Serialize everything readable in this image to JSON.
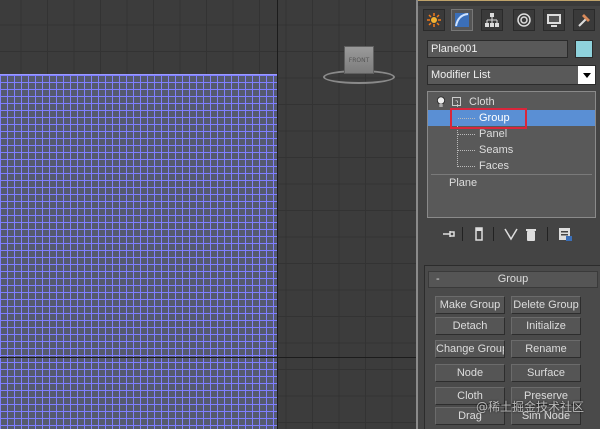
{
  "viewport": {
    "viewcube_label": "FRONT"
  },
  "panel": {
    "tabs": [
      {
        "name": "create",
        "icon": "sunburst-icon"
      },
      {
        "name": "modify",
        "icon": "modify-arc-icon"
      },
      {
        "name": "hierarchy",
        "icon": "hierarchy-icon"
      },
      {
        "name": "motion",
        "icon": "motion-icon"
      },
      {
        "name": "display",
        "icon": "display-monitor-icon"
      },
      {
        "name": "utilities",
        "icon": "hammer-icon"
      }
    ],
    "object_name": "Plane001",
    "object_color": "#8fd2dc",
    "modifier_list_label": "Modifier List",
    "stack": {
      "modifier": "Cloth",
      "subobjects": [
        "Group",
        "Panel",
        "Seams",
        "Faces"
      ],
      "selected": "Group",
      "base_object": "Plane"
    },
    "rollout": {
      "title": "Group",
      "collapse_symbol": "-",
      "buttons": [
        [
          "Make Group",
          "Delete Group"
        ],
        [
          "Detach",
          "Initialize"
        ],
        [
          "Change Group",
          "Rename"
        ],
        [
          "Node",
          "Surface"
        ],
        [
          "Cloth",
          "Preserve"
        ],
        [
          "Drag",
          "Sim Node"
        ]
      ]
    }
  },
  "colors": {
    "selection_highlight": "#5a8fd4",
    "annotation_box": "#d9263b",
    "mesh_wire": "#7f7fff"
  },
  "watermark": "@稀土掘金技术社区"
}
